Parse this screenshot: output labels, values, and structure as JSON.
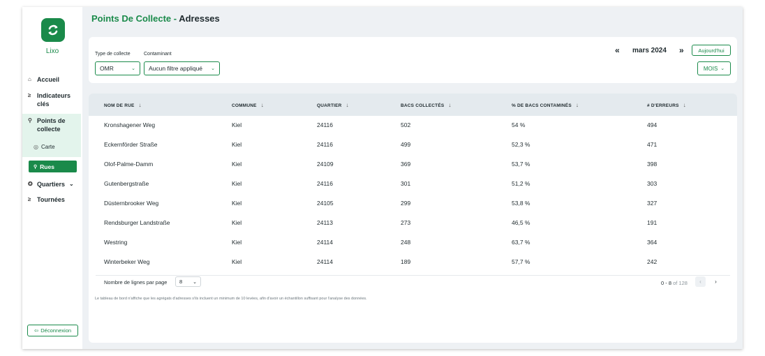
{
  "app": {
    "name": "Lixo",
    "brand_color": "#1a8a4a",
    "logo_icon": "recycle-arrows-icon"
  },
  "sidebar": {
    "items": [
      {
        "label": "Accueil",
        "icon": "home-icon"
      },
      {
        "label": "Indicateurs clés",
        "icon": "chart-icon"
      },
      {
        "label": "Points de collecte",
        "icon": "location-pin-icon"
      },
      {
        "label": "Carte",
        "icon": "map-marker-icon"
      },
      {
        "label": "Rues",
        "icon": "location-pin-icon"
      },
      {
        "label": "Quartiers",
        "icon": "target-icon"
      },
      {
        "label": "Tournées",
        "icon": "route-icon"
      }
    ],
    "logout_label": "Déconnexion"
  },
  "header": {
    "title_prefix": "Points De Collecte -",
    "title_main": "Adresses"
  },
  "filters": {
    "type_label": "Type de collecte",
    "type_value": "OMR",
    "contaminant_label": "Contaminant",
    "contaminant_value": "Aucun filtre appliqué",
    "prev_arrow": "«",
    "next_arrow": "»",
    "period": "mars 2024",
    "today_label": "Aujourd'hui",
    "granularity": "MOIS"
  },
  "table": {
    "columns": [
      "NOM DE RUE",
      "COMMUNE",
      "QUARTIER",
      "BACS COLLECTÉS",
      "% DE BACS CONTAMINÉS",
      "# D'ERREURS"
    ],
    "rows": [
      [
        "Kronshagener Weg",
        "Kiel",
        "24116",
        "502",
        "54 %",
        "494"
      ],
      [
        "Eckernförder Straße",
        "Kiel",
        "24116",
        "499",
        "52,3 %",
        "471"
      ],
      [
        "Olof-Palme-Damm",
        "Kiel",
        "24109",
        "369",
        "53,7 %",
        "398"
      ],
      [
        "Gutenbergstraße",
        "Kiel",
        "24116",
        "301",
        "51,2 %",
        "303"
      ],
      [
        "Düsternbrooker Weg",
        "Kiel",
        "24105",
        "299",
        "53,8 %",
        "327"
      ],
      [
        "Rendsburger Landstraße",
        "Kiel",
        "24113",
        "273",
        "46,5 %",
        "191"
      ],
      [
        "Westring",
        "Kiel",
        "24114",
        "248",
        "63,7 %",
        "364"
      ],
      [
        "Winterbeker Weg",
        "Kiel",
        "24114",
        "189",
        "57,7 %",
        "242"
      ]
    ],
    "rows_per_page_label": "Nombre de lignes par page",
    "rows_per_page_value": "8",
    "pagination_range": "0 - 8",
    "pagination_total": "of 128",
    "prev_page": "‹",
    "next_page": "›"
  },
  "note": "Le tableau de bord n'affiche que les agrégats d'adresses s'ils incluent un minimum de 10 levées, afin d'avoir un échantillon suffisant pour l'analyse des données."
}
